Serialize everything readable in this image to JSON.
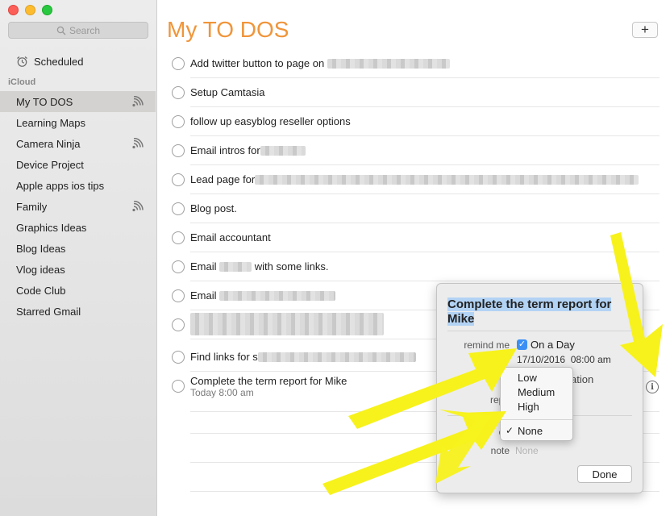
{
  "sidebar": {
    "search_placeholder": "Search",
    "scheduled_label": "Scheduled",
    "section_label": "iCloud",
    "lists": [
      {
        "label": "My TO DOS",
        "selected": true,
        "shared": true
      },
      {
        "label": "Learning Maps",
        "selected": false,
        "shared": false
      },
      {
        "label": "Camera Ninja",
        "selected": false,
        "shared": true
      },
      {
        "label": "Device Project",
        "selected": false,
        "shared": false
      },
      {
        "label": "Apple apps ios tips",
        "selected": false,
        "shared": false
      },
      {
        "label": "Family",
        "selected": false,
        "shared": true
      },
      {
        "label": "Graphics Ideas",
        "selected": false,
        "shared": false
      },
      {
        "label": "Blog Ideas",
        "selected": false,
        "shared": false
      },
      {
        "label": "Vlog ideas",
        "selected": false,
        "shared": false
      },
      {
        "label": "Code Club",
        "selected": false,
        "shared": false
      },
      {
        "label": "Starred Gmail",
        "selected": false,
        "shared": false
      }
    ]
  },
  "main": {
    "title": "My TO DOS",
    "add_label": "+",
    "tasks": [
      {
        "text": "Add twitter button to page on"
      },
      {
        "text": "Setup Camtasia"
      },
      {
        "text": "follow up easyblog reseller options"
      },
      {
        "text": "Email intros for"
      },
      {
        "text": "Lead page for"
      },
      {
        "text": "Blog post."
      },
      {
        "text": "Email accountant"
      },
      {
        "text": "Email",
        "text2": "with some links."
      },
      {
        "text": "Email"
      },
      {
        "text": ""
      },
      {
        "text": "Find links for s"
      },
      {
        "text": "Complete the term report for Mike",
        "sub": "Today 8:00 am"
      }
    ]
  },
  "popover": {
    "title_line1": "Complete the term report for",
    "title_line2": "Mike",
    "remind_me_label": "remind me",
    "on_a_day_label": "On a Day",
    "on_a_day_checked": true,
    "date": "17/10/2016",
    "time": "08:00 am",
    "location_partial": "ation",
    "repeat_partial": "repe",
    "priority_partial": "ori",
    "note_label": "note",
    "note_placeholder": "None",
    "done_label": "Done"
  },
  "priority_menu": {
    "options": [
      "Low",
      "Medium",
      "High",
      "None"
    ],
    "selected": "None"
  },
  "info_icon_label": "i",
  "colors": {
    "title_orange": "#f0953a",
    "selection": "#d4d2d0",
    "highlight_blue": "#b3d3f5",
    "checkbox_blue": "#3b8ff4",
    "arrow_yellow": "#f7f21c"
  }
}
